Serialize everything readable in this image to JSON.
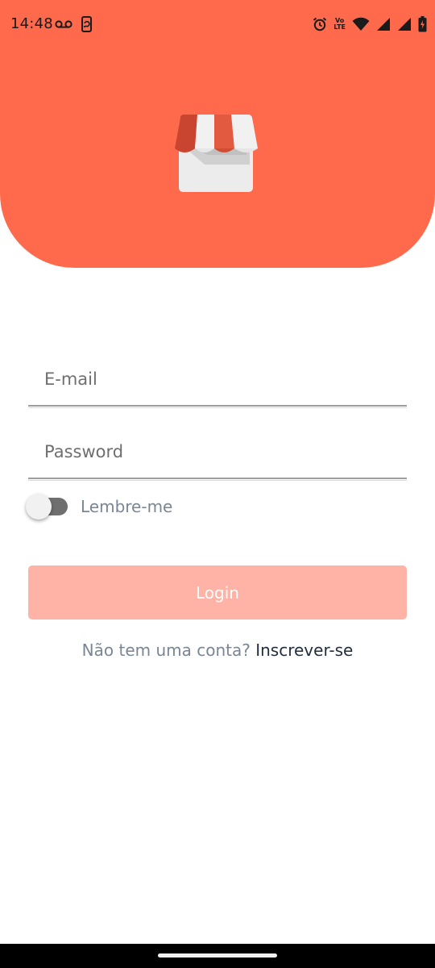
{
  "status_bar": {
    "time": "14:48",
    "left_icons": [
      "voicemail-icon",
      "phone-sync-icon"
    ],
    "right_icons": [
      "alarm-icon",
      "volte-icon",
      "wifi-icon",
      "signal-icon",
      "signal-icon",
      "battery-charging-icon"
    ],
    "volte_top": "Vo",
    "volte_bottom": "LTE"
  },
  "header": {
    "color": "#ff6a4d",
    "logo": "store-icon"
  },
  "form": {
    "email": {
      "placeholder": "E-mail",
      "value": ""
    },
    "password": {
      "placeholder": "Password",
      "value": ""
    },
    "remember": {
      "label": "Lembre-me",
      "enabled": false
    },
    "login_label": "Login",
    "login_color": "#ffb3a6"
  },
  "signup": {
    "question": "Não tem uma conta?",
    "link_label": "Inscrever-se"
  }
}
